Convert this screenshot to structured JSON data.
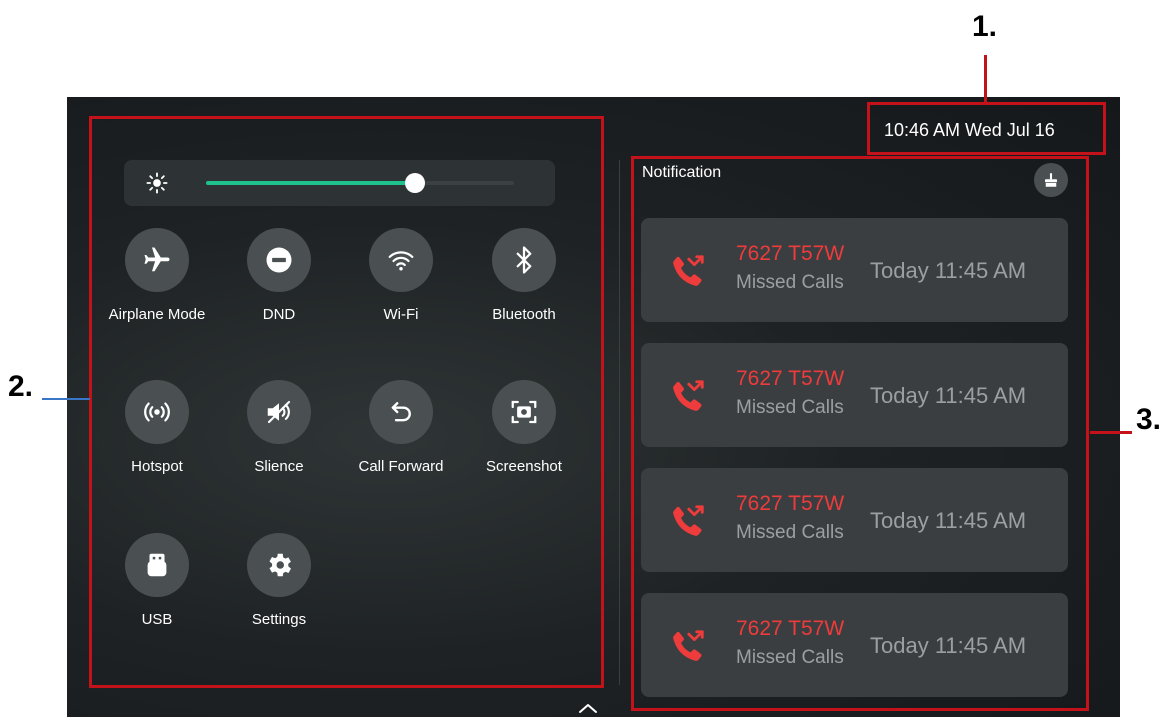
{
  "callouts": {
    "one": "1.",
    "two": "2.",
    "three": "3."
  },
  "status": {
    "datetime": "10:46 AM  Wed Jul 16"
  },
  "brightness": {
    "level_percent": 68,
    "icon": "sun-icon"
  },
  "quick_settings": [
    {
      "label": "Airplane Mode",
      "icon": "airplane-icon"
    },
    {
      "label": "DND",
      "icon": "dnd-icon"
    },
    {
      "label": "Wi-Fi",
      "icon": "wifi-icon"
    },
    {
      "label": "Bluetooth",
      "icon": "bluetooth-icon"
    },
    {
      "label": "Hotspot",
      "icon": "hotspot-icon"
    },
    {
      "label": "Slience",
      "icon": "mute-icon"
    },
    {
      "label": "Call Forward",
      "icon": "call-forward-icon"
    },
    {
      "label": "Screenshot",
      "icon": "screenshot-icon"
    },
    {
      "label": "USB",
      "icon": "usb-icon"
    },
    {
      "label": "Settings",
      "icon": "gear-icon"
    }
  ],
  "notifications": {
    "title": "Notification",
    "clear_icon": "clear-all-icon",
    "items": [
      {
        "name": "7627 T57W",
        "subtitle": "Missed Calls",
        "time": "Today 11:45 AM",
        "icon": "missed-call-icon"
      },
      {
        "name": "7627 T57W",
        "subtitle": "Missed Calls",
        "time": "Today 11:45 AM",
        "icon": "missed-call-icon"
      },
      {
        "name": "7627 T57W",
        "subtitle": "Missed Calls",
        "time": "Today 11:45 AM",
        "icon": "missed-call-icon"
      },
      {
        "name": "7627 T57W",
        "subtitle": "Missed Calls",
        "time": "Today 11:45 AM",
        "icon": "missed-call-icon"
      }
    ]
  },
  "colors": {
    "annotation_red": "#c4121a",
    "slider_accent": "#1fc28c",
    "missed_call_red": "#ee3b3b",
    "tile_bg": "#4a5051"
  }
}
